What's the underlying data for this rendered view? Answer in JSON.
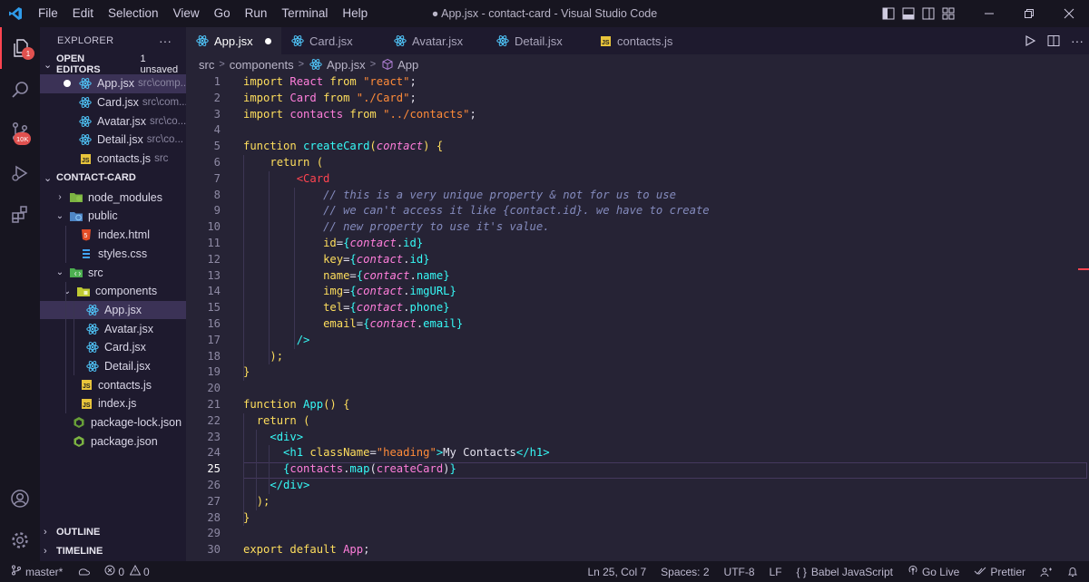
{
  "titlebar": {
    "menu": [
      "File",
      "Edit",
      "Selection",
      "View",
      "Go",
      "Run",
      "Terminal",
      "Help"
    ],
    "window_title": "● App.jsx - contact-card - Visual Studio Code"
  },
  "activity": {
    "explorer_badge": "1",
    "scm_badge": "10K"
  },
  "sidebar": {
    "title": "EXPLORER",
    "more": "···",
    "open_editors": {
      "label": "OPEN EDITORS",
      "unsaved": "1 unsaved",
      "items": [
        {
          "name": "App.jsx",
          "path": "src\\comp...",
          "modified": true
        },
        {
          "name": "Card.jsx",
          "path": "src\\com..."
        },
        {
          "name": "Avatar.jsx",
          "path": "src\\co..."
        },
        {
          "name": "Detail.jsx",
          "path": "src\\co..."
        },
        {
          "name": "contacts.js",
          "path": "src"
        }
      ]
    },
    "project": {
      "label": "CONTACT-CARD",
      "items": [
        {
          "name": "node_modules"
        },
        {
          "name": "public"
        },
        {
          "name": "index.html"
        },
        {
          "name": "styles.css"
        },
        {
          "name": "src"
        },
        {
          "name": "components"
        },
        {
          "name": "App.jsx"
        },
        {
          "name": "Avatar.jsx"
        },
        {
          "name": "Card.jsx"
        },
        {
          "name": "Detail.jsx"
        },
        {
          "name": "contacts.js"
        },
        {
          "name": "index.js"
        },
        {
          "name": "package-lock.json"
        },
        {
          "name": "package.json"
        }
      ]
    },
    "outline": "OUTLINE",
    "timeline": "TIMELINE"
  },
  "tabs": [
    {
      "label": "App.jsx",
      "active": true,
      "modified": true
    },
    {
      "label": "Card.jsx"
    },
    {
      "label": "Avatar.jsx"
    },
    {
      "label": "Detail.jsx"
    },
    {
      "label": "contacts.js"
    }
  ],
  "breadcrumb": [
    "src",
    "components",
    "App.jsx",
    "App"
  ],
  "editor": {
    "current_line": 25,
    "lines": [
      [
        [
          "k",
          "import "
        ],
        [
          "v",
          "React "
        ],
        [
          "k",
          "from "
        ],
        [
          "s",
          "\"react\""
        ],
        [
          "p",
          ";"
        ]
      ],
      [
        [
          "k",
          "import "
        ],
        [
          "v",
          "Card "
        ],
        [
          "k",
          "from "
        ],
        [
          "s",
          "\"./Card\""
        ],
        [
          "p",
          ";"
        ]
      ],
      [
        [
          "k",
          "import "
        ],
        [
          "v",
          "contacts "
        ],
        [
          "k",
          "from "
        ],
        [
          "s",
          "\"../contacts\""
        ],
        [
          "p",
          ";"
        ]
      ],
      [],
      [
        [
          "k",
          "function "
        ],
        [
          "f",
          "createCard"
        ],
        [
          "a",
          "("
        ],
        [
          "i",
          "contact"
        ],
        [
          "a",
          ") {"
        ]
      ],
      [
        [
          "p",
          "    "
        ],
        [
          "k",
          "return "
        ],
        [
          "a",
          "("
        ]
      ],
      [
        [
          "p",
          "        "
        ],
        [
          "t",
          "<Card"
        ]
      ],
      [
        [
          "p",
          "            "
        ],
        [
          "c",
          "// this is a very unique property & not for us to use"
        ]
      ],
      [
        [
          "p",
          "            "
        ],
        [
          "c",
          "// we can't access it like {contact.id}. we have to create"
        ]
      ],
      [
        [
          "p",
          "            "
        ],
        [
          "c",
          "// new property to use it's value."
        ]
      ],
      [
        [
          "p",
          "            "
        ],
        [
          "a",
          "id"
        ],
        [
          "p",
          "="
        ],
        [
          "br",
          "{"
        ],
        [
          "i",
          "contact"
        ],
        [
          "p",
          "."
        ],
        [
          "pr",
          "id"
        ],
        [
          "br",
          "}"
        ]
      ],
      [
        [
          "p",
          "            "
        ],
        [
          "a",
          "key"
        ],
        [
          "p",
          "="
        ],
        [
          "br",
          "{"
        ],
        [
          "i",
          "contact"
        ],
        [
          "p",
          "."
        ],
        [
          "pr",
          "id"
        ],
        [
          "br",
          "}"
        ]
      ],
      [
        [
          "p",
          "            "
        ],
        [
          "a",
          "name"
        ],
        [
          "p",
          "="
        ],
        [
          "br",
          "{"
        ],
        [
          "i",
          "contact"
        ],
        [
          "p",
          "."
        ],
        [
          "pr",
          "name"
        ],
        [
          "br",
          "}"
        ]
      ],
      [
        [
          "p",
          "            "
        ],
        [
          "a",
          "img"
        ],
        [
          "p",
          "="
        ],
        [
          "br",
          "{"
        ],
        [
          "i",
          "contact"
        ],
        [
          "p",
          "."
        ],
        [
          "pr",
          "imgURL"
        ],
        [
          "br",
          "}"
        ]
      ],
      [
        [
          "p",
          "            "
        ],
        [
          "a",
          "tel"
        ],
        [
          "p",
          "="
        ],
        [
          "br",
          "{"
        ],
        [
          "i",
          "contact"
        ],
        [
          "p",
          "."
        ],
        [
          "pr",
          "phone"
        ],
        [
          "br",
          "}"
        ]
      ],
      [
        [
          "p",
          "            "
        ],
        [
          "a",
          "email"
        ],
        [
          "p",
          "="
        ],
        [
          "br",
          "{"
        ],
        [
          "i",
          "contact"
        ],
        [
          "p",
          "."
        ],
        [
          "pr",
          "email"
        ],
        [
          "br",
          "}"
        ]
      ],
      [
        [
          "p",
          "        "
        ],
        [
          "br",
          "/>"
        ]
      ],
      [
        [
          "p",
          "    "
        ],
        [
          "a",
          ");"
        ]
      ],
      [
        [
          "a",
          "}"
        ]
      ],
      [],
      [
        [
          "k",
          "function "
        ],
        [
          "f",
          "App"
        ],
        [
          "a",
          "() {"
        ]
      ],
      [
        [
          "p",
          "  "
        ],
        [
          "k",
          "return "
        ],
        [
          "a",
          "("
        ]
      ],
      [
        [
          "p",
          "    "
        ],
        [
          "br",
          "<div>"
        ]
      ],
      [
        [
          "p",
          "      "
        ],
        [
          "br",
          "<h1 "
        ],
        [
          "a",
          "className"
        ],
        [
          "p",
          "="
        ],
        [
          "s",
          "\"heading\""
        ],
        [
          "br",
          ">"
        ],
        [
          "p",
          "My Contacts"
        ],
        [
          "br",
          "</h1>"
        ]
      ],
      [
        [
          "p",
          "      "
        ],
        [
          "br",
          "{"
        ],
        [
          "v",
          "contacts"
        ],
        [
          "p",
          "."
        ],
        [
          "f",
          "map"
        ],
        [
          "p",
          "("
        ],
        [
          "v",
          "createCard"
        ],
        [
          "p",
          ")"
        ],
        [
          "br",
          "}"
        ]
      ],
      [
        [
          "p",
          "    "
        ],
        [
          "br",
          "</div>"
        ]
      ],
      [
        [
          "p",
          "  "
        ],
        [
          "a",
          ");"
        ]
      ],
      [
        [
          "a",
          "}"
        ]
      ],
      [],
      [
        [
          "k",
          "export default "
        ],
        [
          "v",
          "App"
        ],
        [
          "p",
          ";"
        ]
      ]
    ]
  },
  "status": {
    "branch": "master*",
    "errors": "0",
    "warnings": "0",
    "position": "Ln 25, Col 7",
    "spaces": "Spaces: 2",
    "encoding": "UTF-8",
    "eol": "LF",
    "language": "Babel JavaScript",
    "language_icon": "{ }",
    "golive": "Go Live",
    "prettier": "Prettier"
  }
}
